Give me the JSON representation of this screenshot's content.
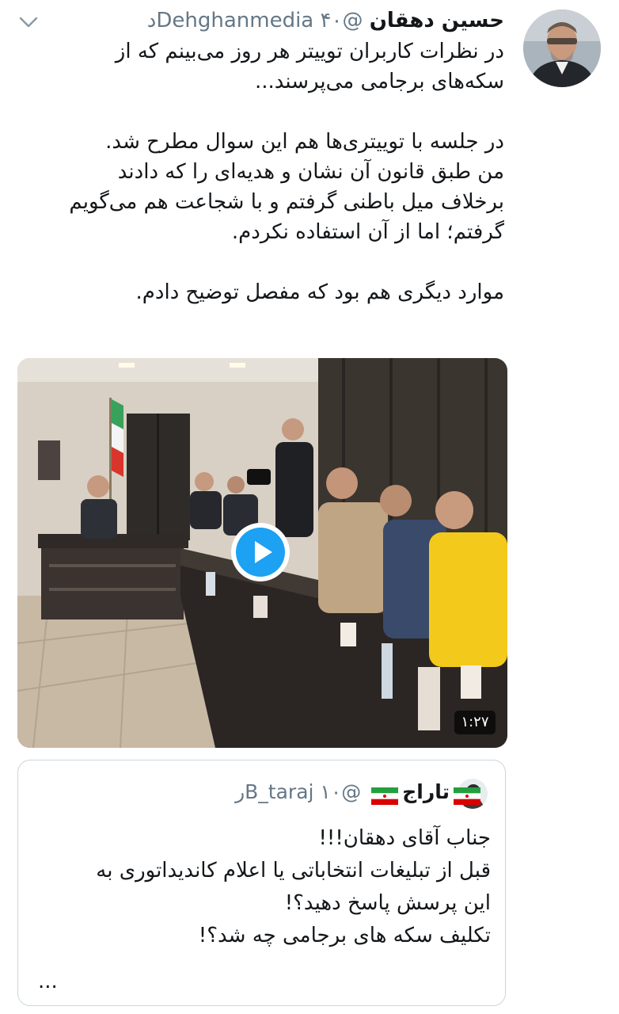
{
  "tweet": {
    "author_name": "حسین دهقان",
    "author_handle": "@Dehghanmedia",
    "time": "۴۰د",
    "text_lines": [
      "در نظرات کاربران توییتر هر روز می‌بینم که از",
      "سکه‌های برجامی می‌پرسند...",
      "",
      "در جلسه با توییتری‌ها هم این سوال مطرح شد.",
      " من طبق قانون آن نشان و هدیه‌ای را که دادند",
      "برخلاف میل باطنی گرفتم و با شجاعت هم می‌گویم",
      "گرفتم؛ اما از آن استفاده نکردم.",
      "",
      "موارد دیگری هم بود که مفصل توضیح دادم."
    ],
    "icons": {
      "avatar": "avatar-photo",
      "chevron": "chevron-down-icon"
    }
  },
  "video": {
    "duration": "۱:۲۷",
    "play_icon": "play-icon",
    "accent": "#1da1f2"
  },
  "quoted_tweet": {
    "author_name": "تاراج",
    "author_handle": "@B_taraj",
    "time": "۱۰ر",
    "flag_icon": "iran-flag-icon",
    "text_lines": [
      "جناب آقای دهقان!!!",
      "قبل از تبلیغات انتخاباتی یا اعلام کاندیداتوری به",
      "این پرسش پاسخ دهید؟!",
      " تکلیف سکه های برجامی چه شد؟!"
    ],
    "ellipsis": "..."
  },
  "colors": {
    "text": "#14171a",
    "secondary": "#657786",
    "border": "#ccd6dd",
    "accent": "#1da1f2"
  }
}
